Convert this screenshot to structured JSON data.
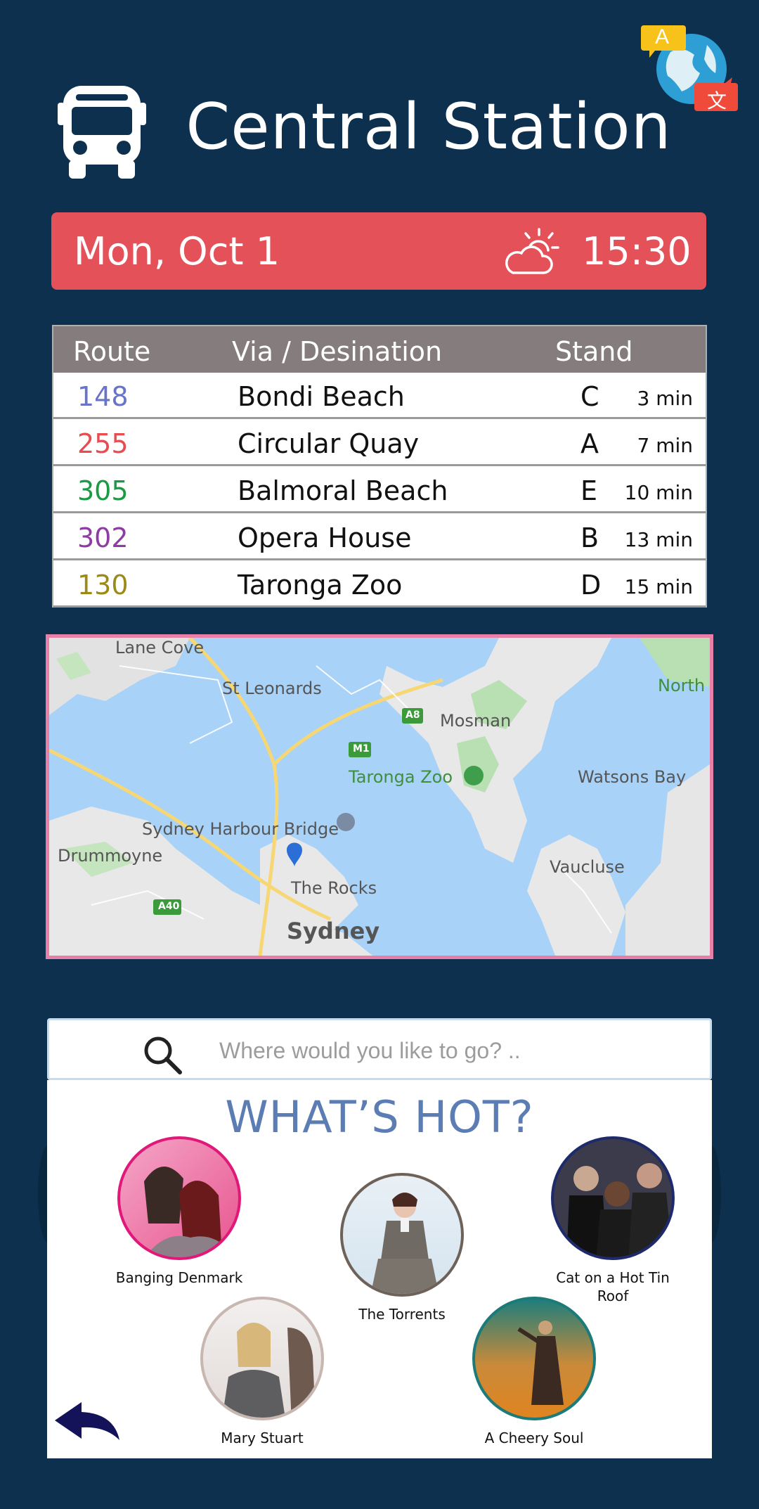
{
  "header": {
    "title": "Central Station",
    "bus_icon": "bus-icon",
    "translate_icon": "translate-icon",
    "translate_glyph_a": "A",
    "translate_glyph_b": "文"
  },
  "status_bar": {
    "date": "Mon, Oct 1",
    "weather_icon": "partly-sunny-icon",
    "time": "15:30",
    "color": "#e45158"
  },
  "departures": {
    "columns": [
      "Route",
      "Via / Desination",
      "Stand"
    ],
    "rows": [
      {
        "route": "148",
        "destination": "Bondi Beach",
        "stand": "C",
        "eta": "3 min",
        "route_color": "#6774c9"
      },
      {
        "route": "255",
        "destination": "Circular Quay",
        "stand": "A",
        "eta": "7 min",
        "route_color": "#e84b50"
      },
      {
        "route": "305",
        "destination": "Balmoral Beach",
        "stand": "E",
        "eta": "10 min",
        "route_color": "#1a9a45"
      },
      {
        "route": "302",
        "destination": "Opera House",
        "stand": "B",
        "eta": "13 min",
        "route_color": "#8e3ba3"
      },
      {
        "route": "130",
        "destination": "Taronga Zoo",
        "stand": "D",
        "eta": "15 min",
        "route_color": "#9c8a18"
      }
    ]
  },
  "map": {
    "labels": [
      "Lane Cove",
      "St Leonards",
      "North H",
      "Mosman",
      "Taronga Zoo",
      "Watsons Bay",
      "Sydney Harbour Bridge",
      "Drummoyne",
      "Vaucluse",
      "The Rocks",
      "Sydney"
    ],
    "shields": [
      "A8",
      "M1",
      "A40"
    ]
  },
  "search": {
    "placeholder": "Where would you like to go? ..",
    "value": ""
  },
  "whats_hot": {
    "title": "WHAT’S HOT?",
    "shows": [
      {
        "name": "Banging Denmark",
        "ring": "#e0187a"
      },
      {
        "name": "The Torrents",
        "ring": "#6e6158"
      },
      {
        "name": "Cat on a Hot Tin Roof",
        "ring": "#1d2a6b"
      },
      {
        "name": "Mary Stuart",
        "ring": "#c8b6b0"
      },
      {
        "name": "A Cheery Soul",
        "ring": "#1c7a78"
      }
    ]
  },
  "navigation": {
    "back_icon": "back-arrow-icon"
  }
}
